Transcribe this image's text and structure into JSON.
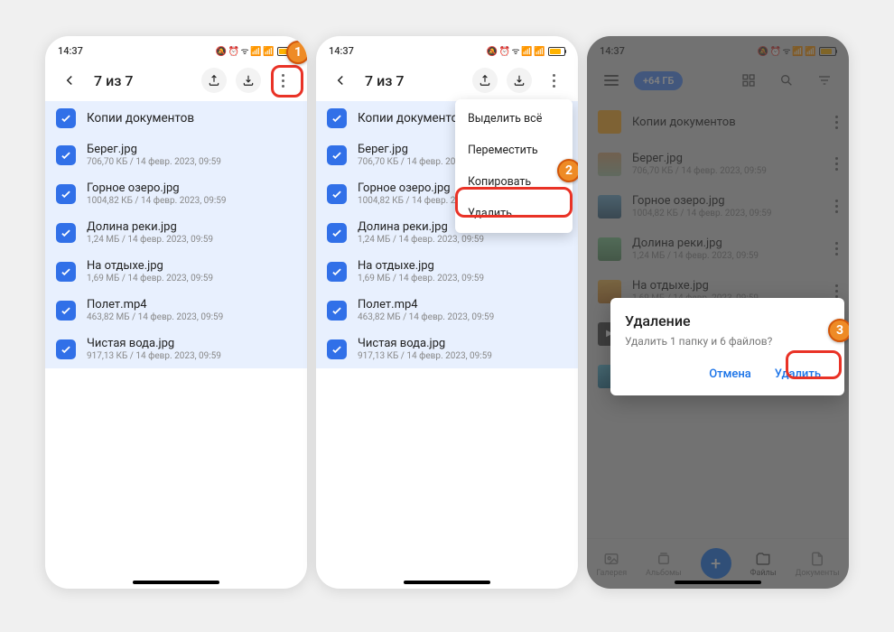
{
  "status": {
    "time": "14:37",
    "icons": "⏰ ⚙ 📶 📶"
  },
  "selection_title": "7 из 7",
  "items": [
    {
      "name": "Копии документов",
      "sub": ""
    },
    {
      "name": "Берег.jpg",
      "sub": "706,70 КБ / 14 февр. 2023, 09:59"
    },
    {
      "name": "Горное озеро.jpg",
      "sub": "1004,82 КБ / 14 февр. 2023, 09:59"
    },
    {
      "name": "Долина реки.jpg",
      "sub": "1,24 МБ / 14 февр. 2023, 09:59"
    },
    {
      "name": "На отдыхе.jpg",
      "sub": "1,69 МБ / 14 февр. 2023, 09:59"
    },
    {
      "name": "Полет.mp4",
      "sub": "463,82 МБ / 14 февр. 2023, 09:59"
    },
    {
      "name": "Чистая вода.jpg",
      "sub": "917,13 КБ / 14 февр. 2023, 09:59"
    }
  ],
  "menu": {
    "select_all": "Выделить всё",
    "move": "Переместить",
    "copy": "Копировать",
    "delete": "Удалить"
  },
  "promo": "+64 ГБ",
  "dialog": {
    "title": "Удаление",
    "msg": "Удалить 1 папку и 6 файлов?",
    "cancel": "Отмена",
    "confirm": "Удалить"
  },
  "nav": {
    "gallery": "Галерея",
    "albums": "Альбомы",
    "files": "Файлы",
    "documents": "Документы"
  },
  "callouts": {
    "c1": "1",
    "c2": "2",
    "c3": "3"
  }
}
